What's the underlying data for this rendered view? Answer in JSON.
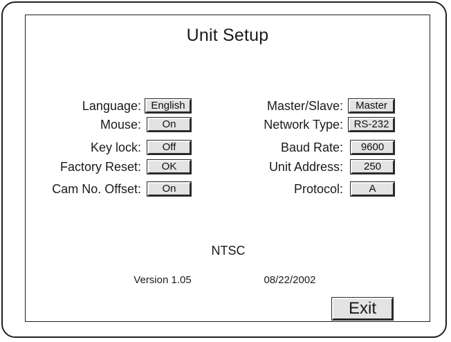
{
  "title": "Unit Setup",
  "left_settings": [
    {
      "label": "Language:",
      "value": "English"
    },
    {
      "label": "Mouse:",
      "value": "On"
    },
    {
      "label": "Key lock:",
      "value": "Off"
    },
    {
      "label": "Factory Reset:",
      "value": "OK"
    },
    {
      "label": "Cam No. Offset:",
      "value": "On"
    }
  ],
  "right_settings": [
    {
      "label": "Master/Slave:",
      "value": "Master"
    },
    {
      "label": "Network Type:",
      "value": "RS-232"
    },
    {
      "label": "Baud Rate:",
      "value": "9600"
    },
    {
      "label": "Unit Address:",
      "value": "250"
    },
    {
      "label": "Protocol:",
      "value": "A"
    }
  ],
  "video_standard": "NTSC",
  "version": "Version 1.05",
  "date": "08/22/2002",
  "exit_label": "Exit"
}
